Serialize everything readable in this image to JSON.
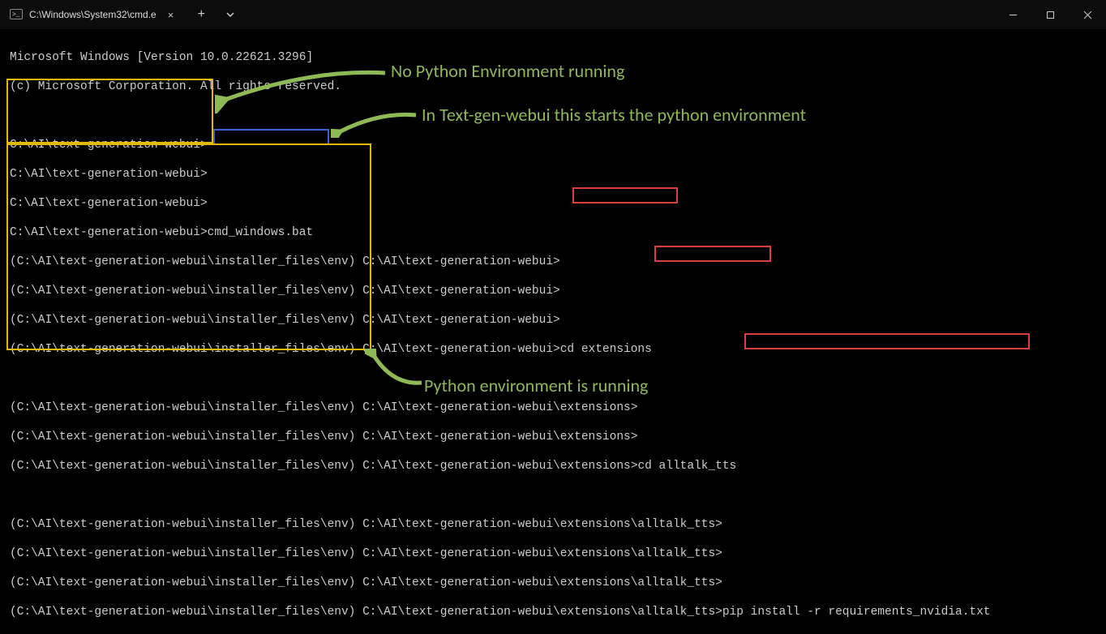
{
  "window": {
    "tab_title": "C:\\Windows\\System32\\cmd.e",
    "tab_close": "×",
    "new_tab": "+",
    "dropdown": "v"
  },
  "banner": {
    "line1": "Microsoft Windows [Version 10.0.22621.3296]",
    "line2": "(c) Microsoft Corporation. All rights reserved."
  },
  "prompts": {
    "base_path": "C:\\AI\\text-generation-webui>",
    "env_prefix": "(C:\\AI\\text-generation-webui\\installer_files\\env) ",
    "ext_path": "C:\\AI\\text-generation-webui\\extensions>",
    "alltalk_path": "C:\\AI\\text-generation-webui\\extensions\\alltalk_tts>"
  },
  "cmds": {
    "cmd_windows": "cmd_windows.bat",
    "cd_ext": "cd extensions",
    "cd_alltalk": "cd alltalk_tts",
    "pip": "pip install -r requirements_nvidia.txt"
  },
  "annotations": {
    "no_env": "No Python Environment running",
    "starts_env": "In Text-gen-webui this starts the python environment",
    "env_running": "Python environment is running"
  },
  "colors": {
    "annot_text": "#8fb955",
    "box_yellow": "#e6b800",
    "box_blue": "#3a63d4",
    "box_red": "#d83f3a"
  }
}
